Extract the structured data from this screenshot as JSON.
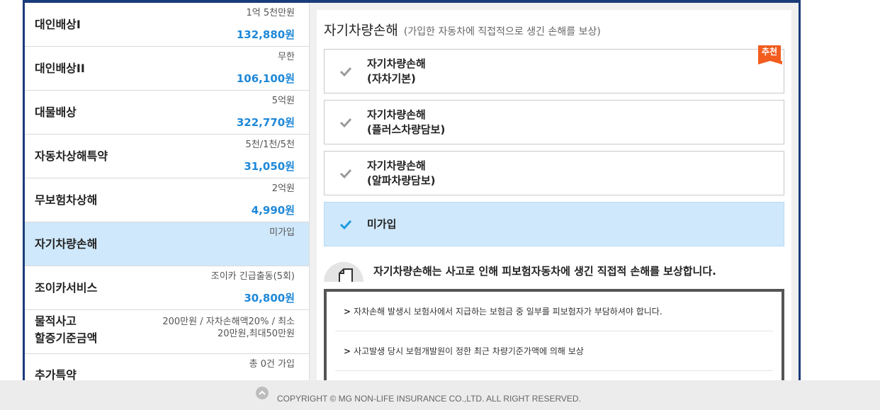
{
  "coverages": [
    {
      "name": "대인배상I",
      "sub": "1억 5천만원",
      "price": "132,880원"
    },
    {
      "name": "대인배상II",
      "sub": "무한",
      "price": "106,100원"
    },
    {
      "name": "대물배상",
      "sub": "5억원",
      "price": "322,770원"
    },
    {
      "name": "자동차상해특약",
      "sub": "5천/1천/5천",
      "price": "31,050원"
    },
    {
      "name": "무보험차상해",
      "sub": "2억원",
      "price": "4,990원"
    },
    {
      "name": "자기차량손해",
      "sub": "미가입",
      "price": ""
    },
    {
      "name": "조이카서비스",
      "sub": "조이카 긴급출동(5회)",
      "price": "30,800원"
    },
    {
      "name_line1": "물적사고",
      "name_line2": "할증기준금액",
      "sub": "200만원 / 자차손해액20% / 최소20만원,최대50만원",
      "price": ""
    },
    {
      "name": "추가특약",
      "sub": "총 0건 가입",
      "price": ""
    }
  ],
  "panel": {
    "title": "자기차량손해",
    "subtitle": "(가입한 자동차에 직접적으로 생긴 손해를 보상)",
    "recommend_badge": "추천",
    "options": [
      {
        "line1": "자기차량손해",
        "line2": "(자차기본)"
      },
      {
        "line1": "자기차량손해",
        "line2": "(플러스차량담보)"
      },
      {
        "line1": "자기차량손해",
        "line2": "(알파차량담보)"
      },
      {
        "line1": "미가입",
        "line2": ""
      }
    ],
    "info_title": "자기차량손해는 사고로 인해 피보험자동차에 생긴 직접적 손해를 보상합니다.",
    "info_items": [
      "자차손해 발생시 보험사에서 지급하는 보험금 중 일부를 피보험자가 부담하셔야 합니다.",
      "사고발생 당시 보험개발원이 정한 최근 차량기준가액에 의해 보상"
    ]
  },
  "footer": {
    "copyright": "COPYRIGHT © MG NON-LIFE INSURANCE CO.,LTD. ALL RIGHT RESERVED."
  },
  "colors": {
    "navy": "#1a3b7a",
    "price_blue": "#1e88d8",
    "selected_bg": "#cfe8fb",
    "badge_orange": "#f25c1f"
  }
}
